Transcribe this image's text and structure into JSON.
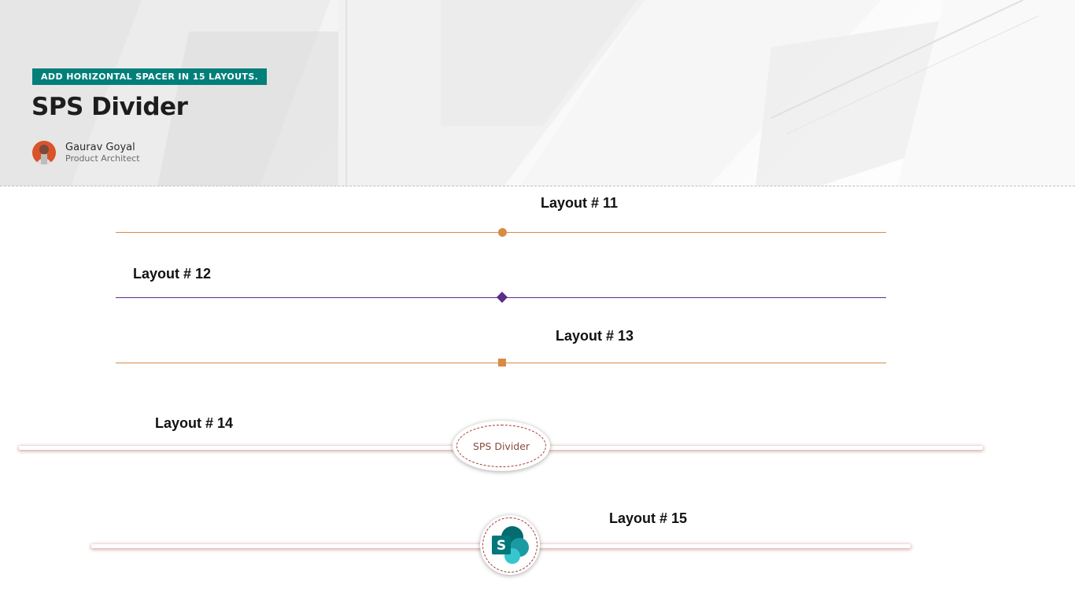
{
  "header": {
    "tag": "ADD HORIZONTAL SPACER IN 15 LAYOUTS.",
    "title": "SPS Divider",
    "author_name": "Gaurav Goyal",
    "author_role": "Product Architect"
  },
  "layouts": [
    {
      "label": "Layout # 11",
      "marker": "circle",
      "color": "#d98a45"
    },
    {
      "label": "Layout # 12",
      "marker": "diamond",
      "color": "#5b2d8e"
    },
    {
      "label": "Layout # 13",
      "marker": "square",
      "color": "#d98a45"
    },
    {
      "label": "Layout # 14",
      "marker": "ellipse-badge",
      "badge_text": "SPS Divider"
    },
    {
      "label": "Layout # 15",
      "marker": "sharepoint-icon-badge",
      "icon_letter": "S"
    }
  ],
  "colors": {
    "accent": "#037f7a",
    "orange": "#d98a45",
    "purple": "#5b2d8e",
    "badge_border": "#a33a2e"
  }
}
